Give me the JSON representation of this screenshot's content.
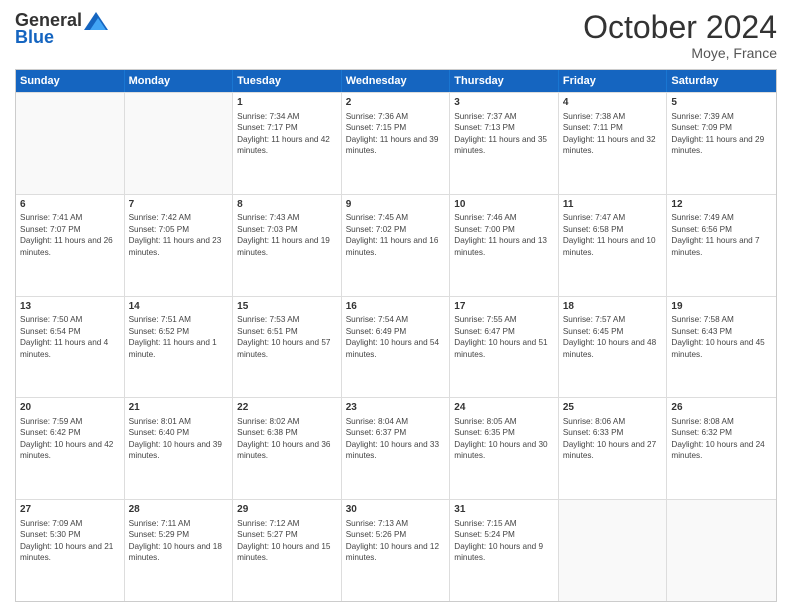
{
  "header": {
    "logo_general": "General",
    "logo_blue": "Blue",
    "month_title": "October 2024",
    "location": "Moye, France"
  },
  "days": [
    "Sunday",
    "Monday",
    "Tuesday",
    "Wednesday",
    "Thursday",
    "Friday",
    "Saturday"
  ],
  "weeks": [
    [
      {
        "day": "",
        "sunrise": "",
        "sunset": "",
        "daylight": "",
        "empty": true
      },
      {
        "day": "",
        "sunrise": "",
        "sunset": "",
        "daylight": "",
        "empty": true
      },
      {
        "day": "1",
        "sunrise": "Sunrise: 7:34 AM",
        "sunset": "Sunset: 7:17 PM",
        "daylight": "Daylight: 11 hours and 42 minutes.",
        "empty": false
      },
      {
        "day": "2",
        "sunrise": "Sunrise: 7:36 AM",
        "sunset": "Sunset: 7:15 PM",
        "daylight": "Daylight: 11 hours and 39 minutes.",
        "empty": false
      },
      {
        "day": "3",
        "sunrise": "Sunrise: 7:37 AM",
        "sunset": "Sunset: 7:13 PM",
        "daylight": "Daylight: 11 hours and 35 minutes.",
        "empty": false
      },
      {
        "day": "4",
        "sunrise": "Sunrise: 7:38 AM",
        "sunset": "Sunset: 7:11 PM",
        "daylight": "Daylight: 11 hours and 32 minutes.",
        "empty": false
      },
      {
        "day": "5",
        "sunrise": "Sunrise: 7:39 AM",
        "sunset": "Sunset: 7:09 PM",
        "daylight": "Daylight: 11 hours and 29 minutes.",
        "empty": false
      }
    ],
    [
      {
        "day": "6",
        "sunrise": "Sunrise: 7:41 AM",
        "sunset": "Sunset: 7:07 PM",
        "daylight": "Daylight: 11 hours and 26 minutes.",
        "empty": false
      },
      {
        "day": "7",
        "sunrise": "Sunrise: 7:42 AM",
        "sunset": "Sunset: 7:05 PM",
        "daylight": "Daylight: 11 hours and 23 minutes.",
        "empty": false
      },
      {
        "day": "8",
        "sunrise": "Sunrise: 7:43 AM",
        "sunset": "Sunset: 7:03 PM",
        "daylight": "Daylight: 11 hours and 19 minutes.",
        "empty": false
      },
      {
        "day": "9",
        "sunrise": "Sunrise: 7:45 AM",
        "sunset": "Sunset: 7:02 PM",
        "daylight": "Daylight: 11 hours and 16 minutes.",
        "empty": false
      },
      {
        "day": "10",
        "sunrise": "Sunrise: 7:46 AM",
        "sunset": "Sunset: 7:00 PM",
        "daylight": "Daylight: 11 hours and 13 minutes.",
        "empty": false
      },
      {
        "day": "11",
        "sunrise": "Sunrise: 7:47 AM",
        "sunset": "Sunset: 6:58 PM",
        "daylight": "Daylight: 11 hours and 10 minutes.",
        "empty": false
      },
      {
        "day": "12",
        "sunrise": "Sunrise: 7:49 AM",
        "sunset": "Sunset: 6:56 PM",
        "daylight": "Daylight: 11 hours and 7 minutes.",
        "empty": false
      }
    ],
    [
      {
        "day": "13",
        "sunrise": "Sunrise: 7:50 AM",
        "sunset": "Sunset: 6:54 PM",
        "daylight": "Daylight: 11 hours and 4 minutes.",
        "empty": false
      },
      {
        "day": "14",
        "sunrise": "Sunrise: 7:51 AM",
        "sunset": "Sunset: 6:52 PM",
        "daylight": "Daylight: 11 hours and 1 minute.",
        "empty": false
      },
      {
        "day": "15",
        "sunrise": "Sunrise: 7:53 AM",
        "sunset": "Sunset: 6:51 PM",
        "daylight": "Daylight: 10 hours and 57 minutes.",
        "empty": false
      },
      {
        "day": "16",
        "sunrise": "Sunrise: 7:54 AM",
        "sunset": "Sunset: 6:49 PM",
        "daylight": "Daylight: 10 hours and 54 minutes.",
        "empty": false
      },
      {
        "day": "17",
        "sunrise": "Sunrise: 7:55 AM",
        "sunset": "Sunset: 6:47 PM",
        "daylight": "Daylight: 10 hours and 51 minutes.",
        "empty": false
      },
      {
        "day": "18",
        "sunrise": "Sunrise: 7:57 AM",
        "sunset": "Sunset: 6:45 PM",
        "daylight": "Daylight: 10 hours and 48 minutes.",
        "empty": false
      },
      {
        "day": "19",
        "sunrise": "Sunrise: 7:58 AM",
        "sunset": "Sunset: 6:43 PM",
        "daylight": "Daylight: 10 hours and 45 minutes.",
        "empty": false
      }
    ],
    [
      {
        "day": "20",
        "sunrise": "Sunrise: 7:59 AM",
        "sunset": "Sunset: 6:42 PM",
        "daylight": "Daylight: 10 hours and 42 minutes.",
        "empty": false
      },
      {
        "day": "21",
        "sunrise": "Sunrise: 8:01 AM",
        "sunset": "Sunset: 6:40 PM",
        "daylight": "Daylight: 10 hours and 39 minutes.",
        "empty": false
      },
      {
        "day": "22",
        "sunrise": "Sunrise: 8:02 AM",
        "sunset": "Sunset: 6:38 PM",
        "daylight": "Daylight: 10 hours and 36 minutes.",
        "empty": false
      },
      {
        "day": "23",
        "sunrise": "Sunrise: 8:04 AM",
        "sunset": "Sunset: 6:37 PM",
        "daylight": "Daylight: 10 hours and 33 minutes.",
        "empty": false
      },
      {
        "day": "24",
        "sunrise": "Sunrise: 8:05 AM",
        "sunset": "Sunset: 6:35 PM",
        "daylight": "Daylight: 10 hours and 30 minutes.",
        "empty": false
      },
      {
        "day": "25",
        "sunrise": "Sunrise: 8:06 AM",
        "sunset": "Sunset: 6:33 PM",
        "daylight": "Daylight: 10 hours and 27 minutes.",
        "empty": false
      },
      {
        "day": "26",
        "sunrise": "Sunrise: 8:08 AM",
        "sunset": "Sunset: 6:32 PM",
        "daylight": "Daylight: 10 hours and 24 minutes.",
        "empty": false
      }
    ],
    [
      {
        "day": "27",
        "sunrise": "Sunrise: 7:09 AM",
        "sunset": "Sunset: 5:30 PM",
        "daylight": "Daylight: 10 hours and 21 minutes.",
        "empty": false
      },
      {
        "day": "28",
        "sunrise": "Sunrise: 7:11 AM",
        "sunset": "Sunset: 5:29 PM",
        "daylight": "Daylight: 10 hours and 18 minutes.",
        "empty": false
      },
      {
        "day": "29",
        "sunrise": "Sunrise: 7:12 AM",
        "sunset": "Sunset: 5:27 PM",
        "daylight": "Daylight: 10 hours and 15 minutes.",
        "empty": false
      },
      {
        "day": "30",
        "sunrise": "Sunrise: 7:13 AM",
        "sunset": "Sunset: 5:26 PM",
        "daylight": "Daylight: 10 hours and 12 minutes.",
        "empty": false
      },
      {
        "day": "31",
        "sunrise": "Sunrise: 7:15 AM",
        "sunset": "Sunset: 5:24 PM",
        "daylight": "Daylight: 10 hours and 9 minutes.",
        "empty": false
      },
      {
        "day": "",
        "sunrise": "",
        "sunset": "",
        "daylight": "",
        "empty": true
      },
      {
        "day": "",
        "sunrise": "",
        "sunset": "",
        "daylight": "",
        "empty": true
      }
    ]
  ]
}
